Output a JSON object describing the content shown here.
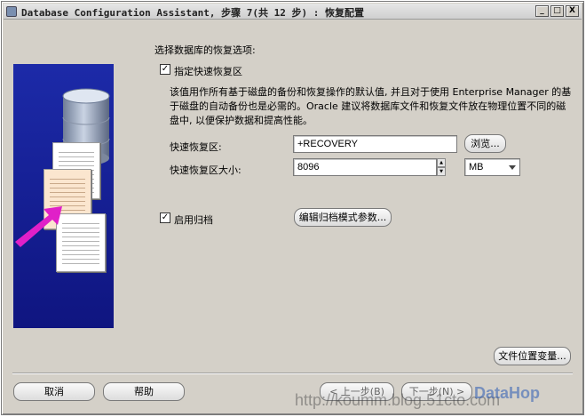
{
  "window": {
    "title": "Database Configuration Assistant, 步骤 7(共 12 步) : 恢复配置",
    "controls": {
      "minimize": "_",
      "maximize": "□",
      "close": "X"
    }
  },
  "section_heading": "选择数据库的恢复选项:",
  "flash_recovery": {
    "checkbox_label": "指定快速恢复区",
    "checked": true,
    "description": "该值用作所有基于磁盘的备份和恢复操作的默认值, 并且对于使用 Enterprise Manager 的基于磁盘的自动备份也是必需的。Oracle 建议将数据库文件和恢复文件放在物理位置不同的磁盘中, 以便保护数据和提高性能。",
    "area_label": "快速恢复区:",
    "area_value": "+RECOVERY",
    "browse_label": "浏览...",
    "size_label": "快速恢复区大小:",
    "size_value": "8096",
    "unit_value": "MB"
  },
  "archive": {
    "checkbox_label": "启用归档",
    "checked": true,
    "edit_button": "编辑归档模式参数..."
  },
  "file_location_button": "文件位置变量...",
  "footer": {
    "cancel": "取消",
    "help": "帮助",
    "back": "< 上一步(B)",
    "next": "下一步(N) >"
  },
  "watermark": {
    "url": "http://koumm.blog.51cto.com",
    "brand": "DataHop"
  },
  "colors": {
    "window_bg": "#d4d0c8",
    "illustration_bg": "#1c2aa8",
    "arrow": "#e020c8"
  }
}
